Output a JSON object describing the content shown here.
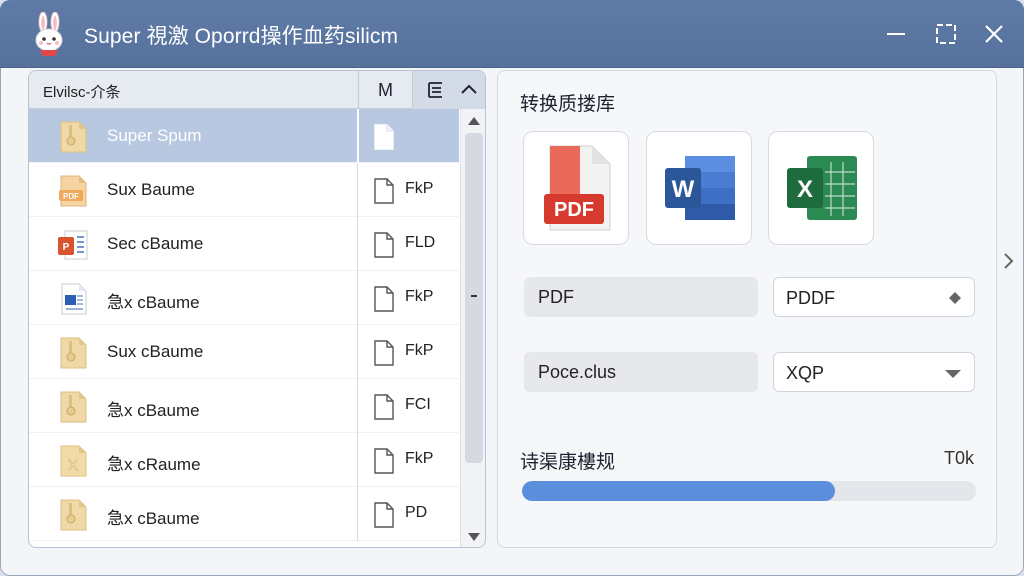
{
  "window": {
    "title": "Super 視激 Oporrd操作血药silicm"
  },
  "file_list": {
    "header": {
      "name_label": "Elvilsc-介条",
      "col_m_label": "M"
    },
    "rows": [
      {
        "name": "Super Spum",
        "type": "",
        "icon": "archive-icon",
        "selected": true
      },
      {
        "name": "Sux Baume",
        "type": "FkP",
        "icon": "pdf-file-icon",
        "selected": false
      },
      {
        "name": "Sec cBaume",
        "type": "FLD",
        "icon": "powerpoint-file-icon",
        "selected": false
      },
      {
        "name": "急x cBaume",
        "type": "FkP",
        "icon": "word-file-icon",
        "selected": false
      },
      {
        "name": "Sux cBaume",
        "type": "FkP",
        "icon": "archive-icon",
        "selected": false
      },
      {
        "name": "急x cBaume",
        "type": "FCI",
        "icon": "archive-icon",
        "selected": false
      },
      {
        "name": "急x cRaume",
        "type": "FkP",
        "icon": "excel-file-icon",
        "selected": false
      },
      {
        "name": "急x cBaume",
        "type": "PD",
        "icon": "archive-icon",
        "selected": false
      }
    ]
  },
  "convert": {
    "title": "转换质搂库",
    "formats": [
      {
        "label": "PDF",
        "icon": "pdf-format-icon"
      },
      {
        "label": "W",
        "icon": "word-format-icon"
      },
      {
        "label": "X",
        "icon": "excel-format-icon"
      }
    ],
    "option1": {
      "label": "PDF",
      "value": "PDDF"
    },
    "option2": {
      "label": "Poce.clus",
      "value": "XQP"
    },
    "progress": {
      "label": "诗渠康樓规",
      "value_text": "T0k",
      "fraction": 0.69
    }
  },
  "colors": {
    "titlebar": "#5a76a0",
    "accent": "#5b8fdc",
    "selected_row": "#b8c8e0"
  }
}
